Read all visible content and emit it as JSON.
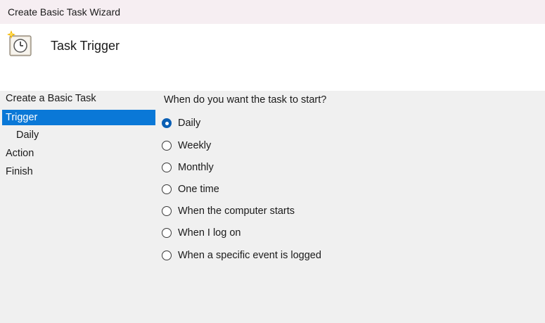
{
  "window": {
    "title": "Create Basic Task Wizard"
  },
  "header": {
    "title": "Task Trigger",
    "icon": "scheduled-task-clock-icon"
  },
  "nav": {
    "items": [
      {
        "label": "Create a Basic Task",
        "selected": false,
        "sub": false
      },
      {
        "label": "Trigger",
        "selected": true,
        "sub": false
      },
      {
        "label": "Daily",
        "selected": false,
        "sub": true
      },
      {
        "label": "Action",
        "selected": false,
        "sub": false
      },
      {
        "label": "Finish",
        "selected": false,
        "sub": false
      }
    ]
  },
  "content": {
    "question": "When do you want the task to start?",
    "selected": "Daily",
    "options": [
      {
        "label": "Daily",
        "checked": true
      },
      {
        "label": "Weekly",
        "checked": false
      },
      {
        "label": "Monthly",
        "checked": false
      },
      {
        "label": "One time",
        "checked": false
      },
      {
        "label": "When the computer starts",
        "checked": false
      },
      {
        "label": "When I log on",
        "checked": false
      },
      {
        "label": "When a specific event is logged",
        "checked": false
      }
    ]
  },
  "colors": {
    "selection": "#0a78d7",
    "panel": "#f0f0f0",
    "header": "#ffffff"
  }
}
